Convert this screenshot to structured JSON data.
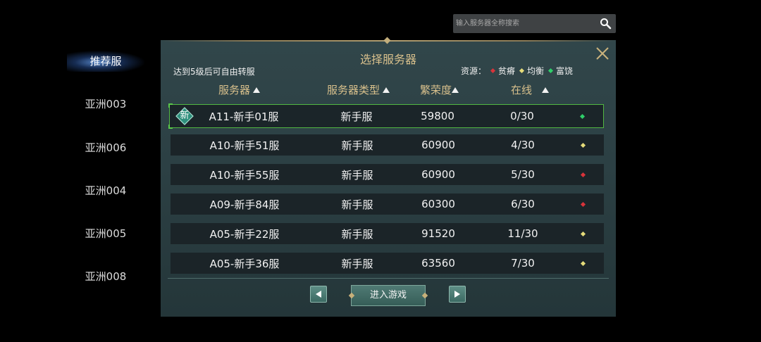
{
  "search": {
    "placeholder": "输入服务器全称搜索",
    "icon": "search-icon"
  },
  "sidebar": {
    "items": [
      {
        "label": "推荐服",
        "active": true
      },
      {
        "label": "亚洲003",
        "active": false
      },
      {
        "label": "亚洲006",
        "active": false
      },
      {
        "label": "亚洲004",
        "active": false
      },
      {
        "label": "亚洲005",
        "active": false
      },
      {
        "label": "亚洲008",
        "active": false
      }
    ]
  },
  "panel": {
    "title": "选择服务器",
    "hint": "达到5级后可自由转服",
    "legend": {
      "label": "资源：",
      "items": [
        {
          "label": "贫瘠",
          "color": "#d8333a"
        },
        {
          "label": "均衡",
          "color": "#e6dc7a"
        },
        {
          "label": "富饶",
          "color": "#2fcf6a"
        }
      ]
    },
    "columns": {
      "name": "服务器",
      "type": "服务器类型",
      "prosperity": "繁荣度",
      "online": "在线"
    },
    "rows": [
      {
        "name": "A11-新手01服",
        "type": "新手服",
        "prosperity": "59800",
        "online": "0/30",
        "resource_color": "#2fcf6a",
        "is_new": true,
        "new_label": "新",
        "selected": true
      },
      {
        "name": "A10-新手51服",
        "type": "新手服",
        "prosperity": "60900",
        "online": "4/30",
        "resource_color": "#e6dc7a",
        "is_new": false,
        "selected": false
      },
      {
        "name": "A10-新手55服",
        "type": "新手服",
        "prosperity": "60900",
        "online": "5/30",
        "resource_color": "#d8333a",
        "is_new": false,
        "selected": false
      },
      {
        "name": "A09-新手84服",
        "type": "新手服",
        "prosperity": "60300",
        "online": "6/30",
        "resource_color": "#d8333a",
        "is_new": false,
        "selected": false
      },
      {
        "name": "A05-新手22服",
        "type": "新手服",
        "prosperity": "91520",
        "online": "11/30",
        "resource_color": "#e6dc7a",
        "is_new": false,
        "selected": false
      },
      {
        "name": "A05-新手36服",
        "type": "新手服",
        "prosperity": "63560",
        "online": "7/30",
        "resource_color": "#e6dc7a",
        "is_new": false,
        "selected": false
      }
    ],
    "enter_label": "进入游戏"
  },
  "colors": {
    "title_gold": "#d8c08c",
    "panel_bg": "#2c4044",
    "row_bg": "#1b2428",
    "selected_border": "#52b842"
  }
}
